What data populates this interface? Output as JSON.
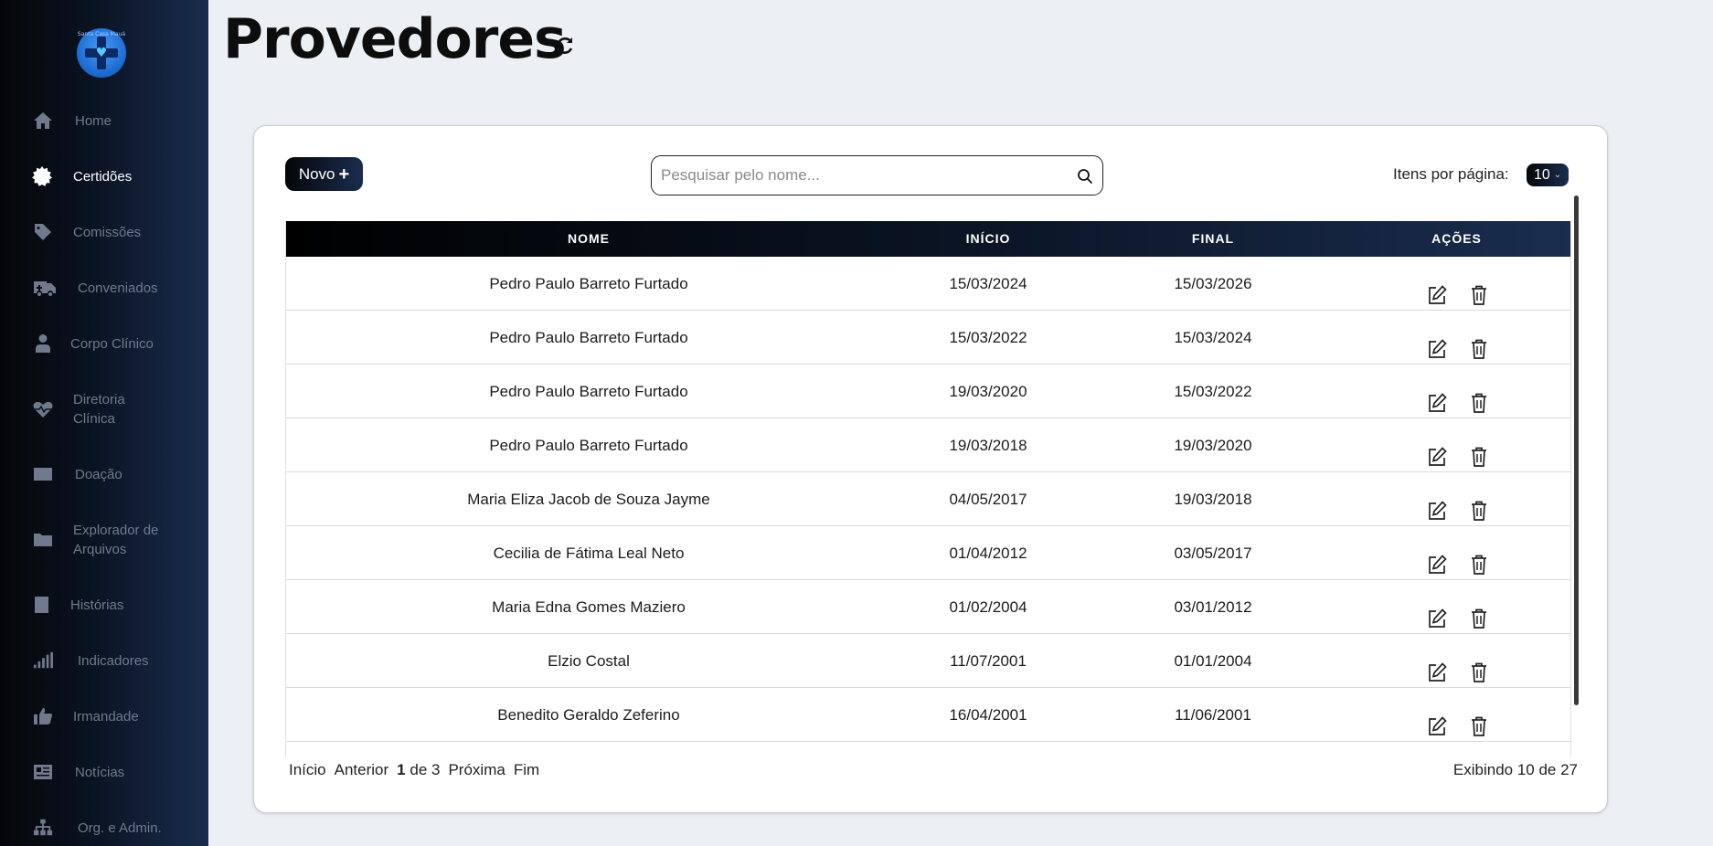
{
  "sidebar": {
    "logo_text": "Santa Casa Mauá",
    "items": [
      {
        "label": "Home",
        "icon": "home-icon",
        "active": false
      },
      {
        "label": "Certidões",
        "icon": "badge-icon",
        "active": true
      },
      {
        "label": "Comissões",
        "icon": "tag-icon",
        "active": false
      },
      {
        "label": "Conveniados",
        "icon": "ambulance-icon",
        "active": false
      },
      {
        "label": "Corpo Clínico",
        "icon": "doctor-icon",
        "active": false
      },
      {
        "label": "Diretoria Clínica",
        "icon": "heartbeat-icon",
        "active": false
      },
      {
        "label": "Doação",
        "icon": "credit-card-icon",
        "active": false
      },
      {
        "label": "Explorador de Arquivos",
        "icon": "folder-icon",
        "active": false
      },
      {
        "label": "Histórias",
        "icon": "book-icon",
        "active": false
      },
      {
        "label": "Indicadores",
        "icon": "signal-bars-icon",
        "active": false
      },
      {
        "label": "Irmandade",
        "icon": "thumbs-up-icon",
        "active": false
      },
      {
        "label": "Notícias",
        "icon": "newspaper-icon",
        "active": false
      },
      {
        "label": "Org. e Admin.",
        "icon": "org-chart-icon",
        "active": false
      }
    ]
  },
  "header": {
    "title": "Provedores",
    "refresh_icon": "refresh-icon"
  },
  "toolbar": {
    "new_label": "Novo",
    "new_icon": "plus-icon",
    "search_placeholder": "Pesquisar pelo nome...",
    "search_value": "",
    "per_page_label": "Itens por página:",
    "per_page_value": "10"
  },
  "table": {
    "columns": [
      "NOME",
      "INÍCIO",
      "FINAL",
      "AÇÕES"
    ],
    "rows": [
      {
        "nome": "Pedro Paulo Barreto Furtado",
        "inicio": "15/03/2024",
        "final": "15/03/2026"
      },
      {
        "nome": "Pedro Paulo Barreto Furtado",
        "inicio": "15/03/2022",
        "final": "15/03/2024"
      },
      {
        "nome": "Pedro Paulo Barreto Furtado",
        "inicio": "19/03/2020",
        "final": "15/03/2022"
      },
      {
        "nome": "Pedro Paulo Barreto Furtado",
        "inicio": "19/03/2018",
        "final": "19/03/2020"
      },
      {
        "nome": "Maria Eliza Jacob de Souza Jayme",
        "inicio": "04/05/2017",
        "final": "19/03/2018"
      },
      {
        "nome": "Cecilia de Fátima Leal Neto",
        "inicio": "01/04/2012",
        "final": "03/05/2017"
      },
      {
        "nome": "Maria Edna Gomes Maziero",
        "inicio": "01/02/2004",
        "final": "03/01/2012"
      },
      {
        "nome": "Elzio Costal",
        "inicio": "11/07/2001",
        "final": "01/01/2004"
      },
      {
        "nome": "Benedito Geraldo Zeferino",
        "inicio": "16/04/2001",
        "final": "11/06/2001"
      }
    ]
  },
  "pagination": {
    "first": "Início",
    "prev": "Anterior",
    "current": "1",
    "of_text": "de 3",
    "next": "Próxima",
    "last": "Fim",
    "showing": "Exibindo 10 de 27"
  },
  "colors": {
    "accent_dark": "#050608",
    "accent_navy": "#1a2d4f",
    "background": "#eceff4"
  }
}
